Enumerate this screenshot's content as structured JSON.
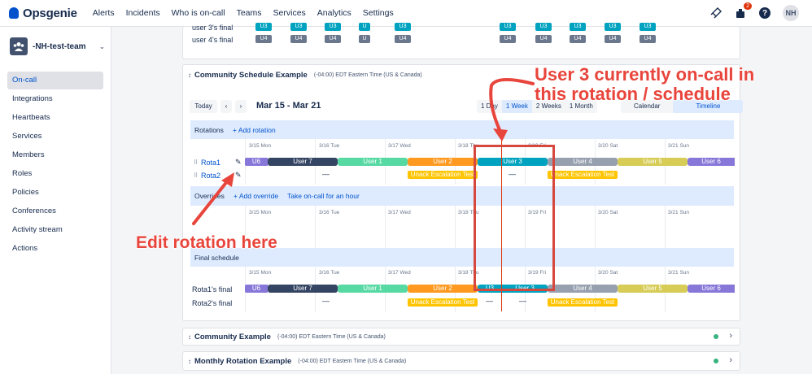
{
  "app": {
    "name": "Opsgenie"
  },
  "nav": {
    "items": [
      "Alerts",
      "Incidents",
      "Who is on-call",
      "Teams",
      "Services",
      "Analytics",
      "Settings"
    ],
    "notif_count": "2",
    "avatar": "NH"
  },
  "sidebar": {
    "team_name": "-NH-test-team",
    "items": [
      "On-call",
      "Integrations",
      "Heartbeats",
      "Services",
      "Members",
      "Roles",
      "Policies",
      "Conferences",
      "Activity stream",
      "Actions"
    ]
  },
  "top_card": {
    "rows": [
      {
        "label": "user 3's final",
        "chips": [
          "U3",
          "U3",
          "U3",
          "U",
          "U3",
          "U3",
          "U3",
          "U3",
          "U3",
          "U3"
        ]
      },
      {
        "label": "user 4's final",
        "chips": [
          "U4",
          "U4",
          "U4",
          "U",
          "U4",
          "U4",
          "U4",
          "U4",
          "U4",
          "U4"
        ]
      }
    ]
  },
  "schedule": {
    "title": "Community Schedule Example",
    "timezone": "(-04:00) EDT Eastern Time (US & Canada)",
    "today": "Today",
    "prev": "‹",
    "next": "›",
    "range": "Mar 15 - Mar 21",
    "views": [
      "1 Day",
      "1 Week",
      "2 Weeks",
      "1 Month"
    ],
    "selected_view": "1 Week",
    "mode_views": [
      "Calendar",
      "Timeline"
    ],
    "selected_mode": "Timeline",
    "rotations_label": "Rotations",
    "add_rotation": "+ Add rotation",
    "overrides_label": "Overrides",
    "add_override": "+ Add override",
    "take_oncall": "Take on-call for an hour",
    "final_label": "Final schedule",
    "days": [
      "3/15 Mon",
      "3/16 Tue",
      "3/17 Wed",
      "3/18 Thu",
      "3/19 Fri",
      "3/20 Sat",
      "3/21 Sun"
    ],
    "rota1": {
      "name": "Rota1",
      "segments": [
        "U6",
        "User 7",
        "User 1",
        "User 2",
        "User 3",
        "User 4",
        "User 5",
        "User 6"
      ]
    },
    "rota2": {
      "name": "Rota2",
      "dash": "—",
      "segments": [
        "Unack Escalation Test",
        "Unack Escalation Test"
      ]
    },
    "final1": {
      "name": "Rota1's final",
      "segments": [
        "U6",
        "User 7",
        "User 1",
        "User 2",
        "U3",
        "User 3",
        "User 4",
        "User 5",
        "User 6"
      ]
    },
    "final2": {
      "name": "Rota2's final",
      "dash": "—",
      "segments": [
        "Unack Escalation Test",
        "Unack Escalation Test"
      ]
    }
  },
  "collapsed": [
    {
      "title": "Community Example",
      "timezone": "(-04:00) EDT Eastern Time (US & Canada)"
    },
    {
      "title": "Monthly Rotation Example",
      "timezone": "(-04:00) EDT Eastern Time (US & Canada)"
    }
  ],
  "annotations": {
    "oncall": [
      "User 3 currently on-call in",
      "this rotation / schedule"
    ],
    "edit": "Edit rotation here"
  },
  "colors": {
    "u6": "#8777d9",
    "u7": "#344563",
    "u1": "#57d9a3",
    "u2": "#ff991f",
    "u3": "#00a3bf",
    "u4": "#97a0af",
    "u5": "#d6cc56",
    "unack": "#ffc400",
    "annotation": "#e8453c"
  }
}
